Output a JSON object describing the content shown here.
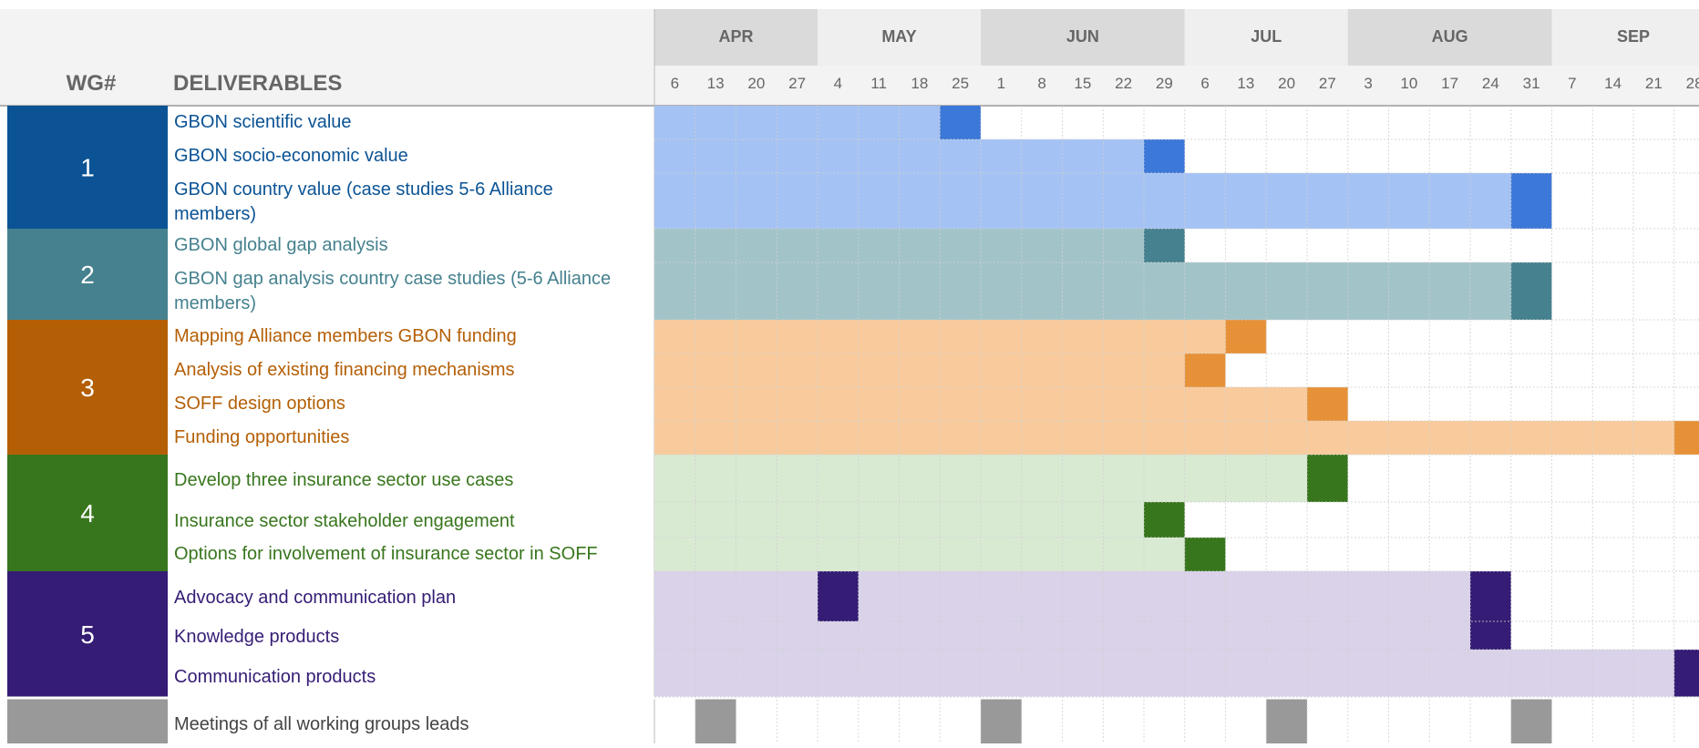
{
  "chart_data": {
    "type": "gantt",
    "header": {
      "wg": "WG#",
      "deliverables": "DELIVERABLES"
    },
    "months": [
      "APR",
      "MAY",
      "JUN",
      "JUL",
      "AUG",
      "SEP"
    ],
    "week_days": [
      "6",
      "13",
      "20",
      "27",
      "4",
      "11",
      "18",
      "25",
      "1",
      "8",
      "15",
      "22",
      "29",
      "6",
      "13",
      "20",
      "27",
      "3",
      "10",
      "17",
      "24",
      "31",
      "7",
      "14",
      "21",
      "28"
    ],
    "groups": [
      {
        "wg": "1",
        "color": "#0B5394",
        "text_color": "#0B5394",
        "fill": "#A4C2F4",
        "milestone": "#3C78D8",
        "rows": [
          {
            "label": "GBON scientific value",
            "milestone_week": "May 25"
          },
          {
            "label": "GBON socio-economic value",
            "milestone_week": "Jun 29"
          },
          {
            "label": "GBON country value (case studies 5-6 Alliance members)",
            "milestone_week": "Aug 31"
          }
        ]
      },
      {
        "wg": "2",
        "color": "#45818E",
        "text_color": "#45818E",
        "fill": "#A2C4C9",
        "milestone": "#45818E",
        "rows": [
          {
            "label": "GBON global gap analysis",
            "milestone_week": "Jun 29"
          },
          {
            "label": "GBON gap analysis country case studies (5-6 Alliance members)",
            "milestone_week": "Aug 31"
          }
        ]
      },
      {
        "wg": "3",
        "color": "#B45F06",
        "text_color": "#B45F06",
        "fill": "#F9CB9C",
        "milestone": "#E69138",
        "rows": [
          {
            "label": "Mapping Alliance members GBON funding",
            "milestone_week": "Jul 13"
          },
          {
            "label": "Analysis of existing financing mechanisms",
            "milestone_week": "Jul 6"
          },
          {
            "label": "SOFF design options",
            "milestone_week": "Jul 27"
          },
          {
            "label": "Funding opportunities",
            "milestone_week": "Sep 28"
          }
        ]
      },
      {
        "wg": "4",
        "color": "#38761D",
        "text_color": "#38761D",
        "fill": "#D9EAD3",
        "milestone": "#38761D",
        "rows": [
          {
            "label": "Develop three insurance sector use cases",
            "milestone_week": "Jul 27"
          },
          {
            "label": "Insurance sector stakeholder engagement",
            "milestone_week": "Jun 29"
          },
          {
            "label": "Options for involvement of insurance sector in SOFF",
            "milestone_week": "Jul 6"
          }
        ]
      },
      {
        "wg": "5",
        "color": "#351C75",
        "text_color": "#351C75",
        "fill": "#D9D2E9",
        "milestone": "#351C75",
        "rows": [
          {
            "label": "Advocacy and communication plan",
            "milestone_weeks": [
              "May 4",
              "Aug 24"
            ]
          },
          {
            "label": "Knowledge products",
            "milestone_week": "Aug 24"
          },
          {
            "label": "Communication products",
            "milestone_week": "Sep 28"
          }
        ]
      }
    ],
    "meetings": {
      "label": "Meetings of all working groups leads",
      "color": "#999999",
      "weeks": [
        "Apr 13",
        "Jun 1",
        "Jul 20",
        "Aug 31"
      ]
    }
  }
}
